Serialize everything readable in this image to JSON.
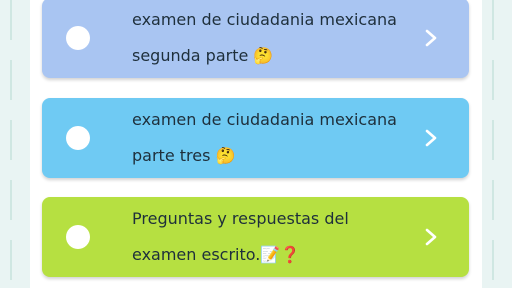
{
  "cards": [
    {
      "line1": "examen de ciudadania mexicana",
      "line2": "segunda parte 🤔",
      "color": "#a9c5f2"
    },
    {
      "line1": "examen de ciudadania mexicana",
      "line2": "parte tres 🤔",
      "color": "#6fcaf3"
    },
    {
      "line1": "Preguntas y respuestas del",
      "line2": "examen escrito.📝❓",
      "color": "#b6e041"
    }
  ]
}
